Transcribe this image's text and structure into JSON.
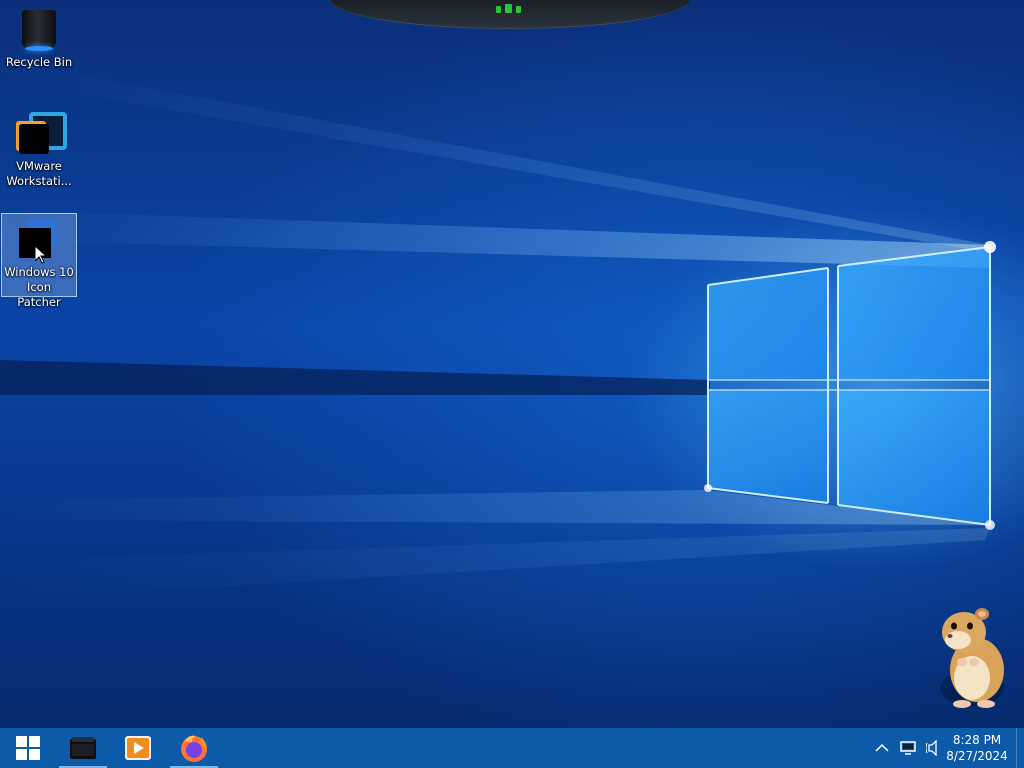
{
  "desktop": {
    "icons": [
      {
        "label": "Recycle Bin",
        "icon": "recycle-bin-icon"
      },
      {
        "label": "VMware Workstati...",
        "icon": "vmware-workstation-icon"
      },
      {
        "label": "Windows 10 Icon Patcher",
        "icon": "icon-patcher-icon",
        "selected": true
      }
    ],
    "selected_icon": "Windows 10 Icon Patcher"
  },
  "taskbar": {
    "start": {
      "icon": "windows-start-icon"
    },
    "pinned": [
      {
        "name": "dark-app",
        "icon": "dark-app-icon",
        "active": true
      },
      {
        "name": "media-player",
        "icon": "media-player-icon",
        "active": false
      },
      {
        "name": "firefox",
        "icon": "firefox-icon",
        "active": true
      }
    ],
    "tray": {
      "icons": [
        "chevron-up-icon",
        "display-icon",
        "speaker-icon"
      ],
      "time": "8:28 PM",
      "date": "8/27/2024"
    }
  },
  "colors": {
    "taskbar": "#0d5aa8",
    "wallpaper_base": "#0a45a8",
    "light_beam": "#8fd6ff",
    "selection": "#78a0dc"
  }
}
